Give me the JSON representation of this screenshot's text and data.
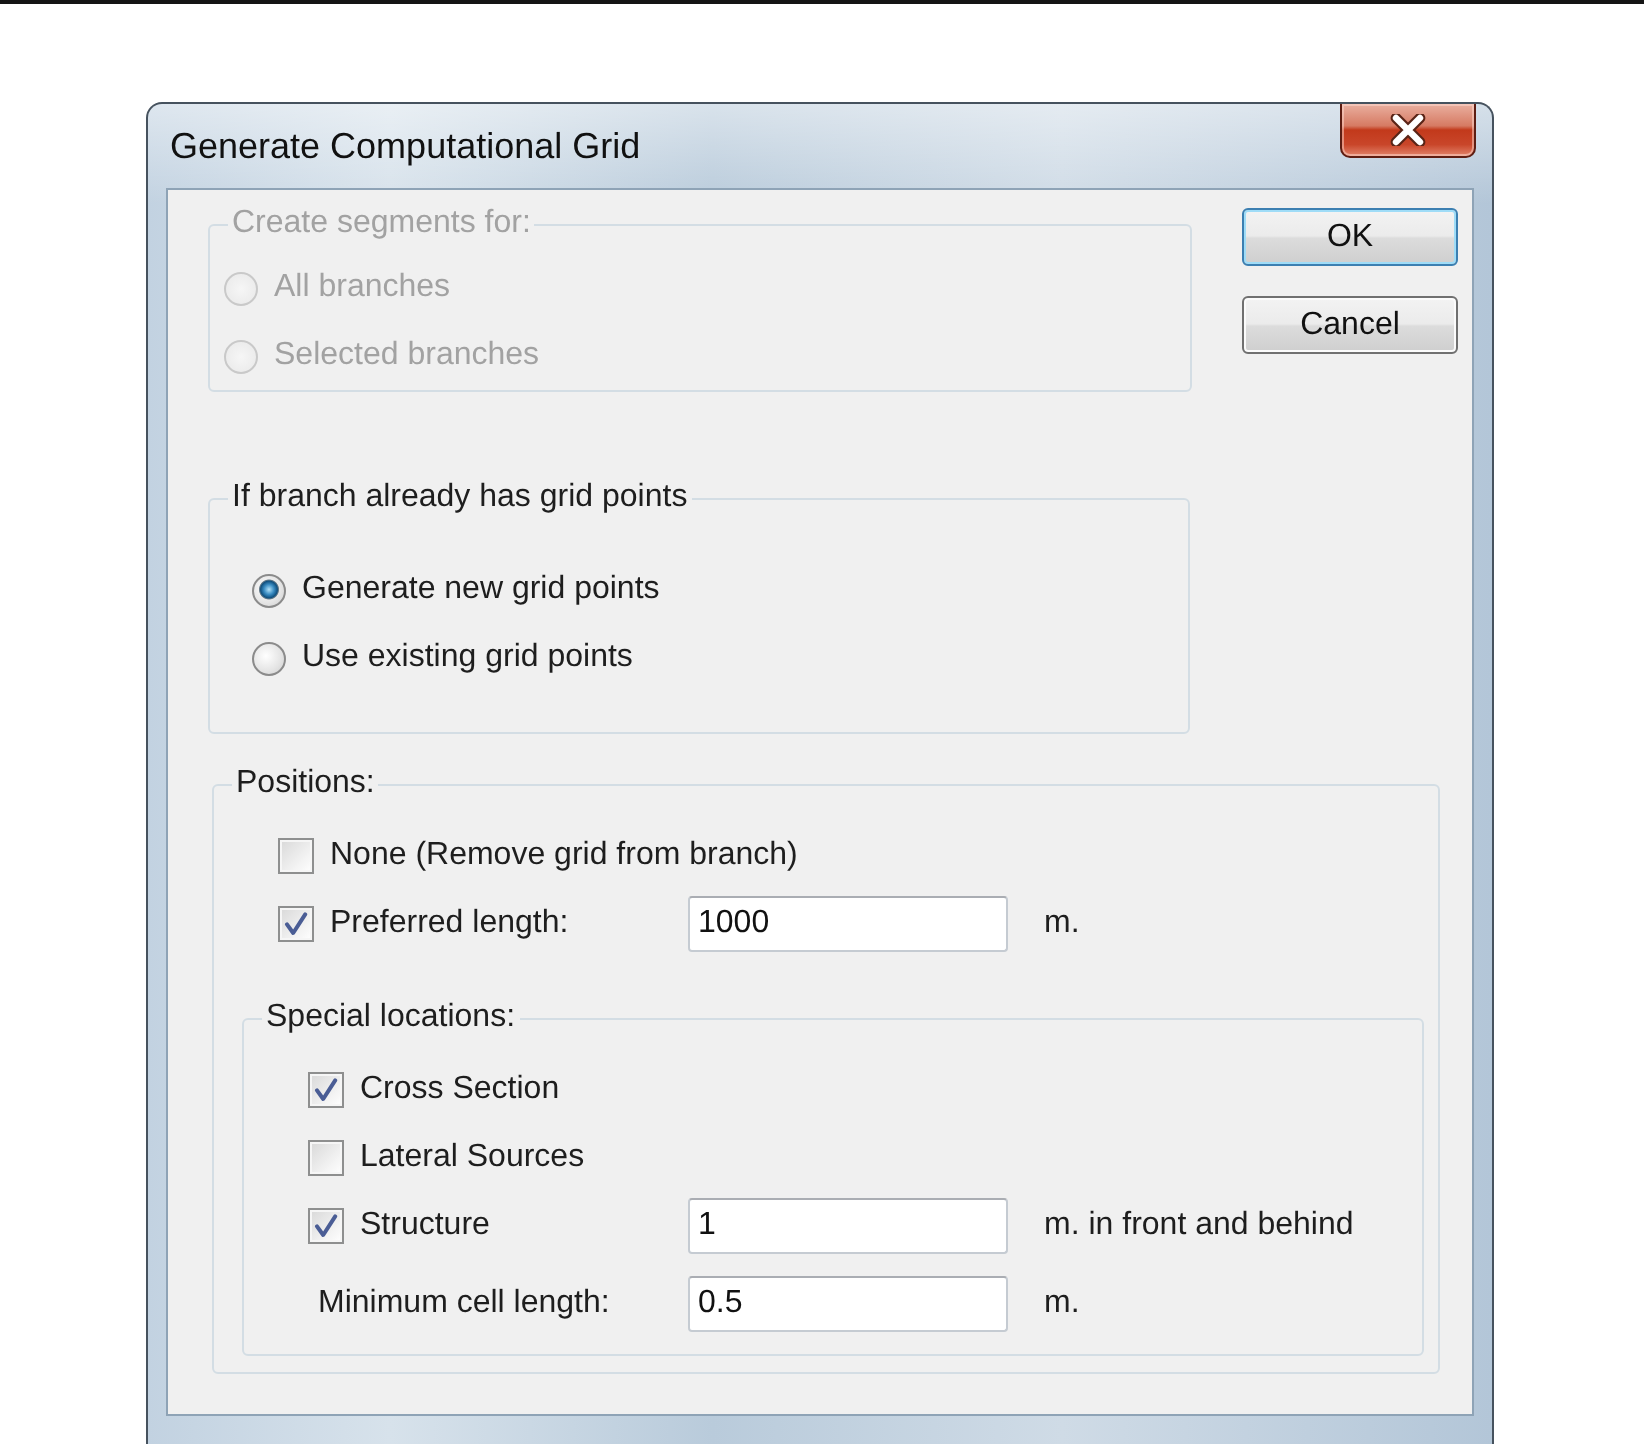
{
  "window": {
    "title": "Generate Computational Grid"
  },
  "create_segments": {
    "title": "Create segments for:",
    "disabled": true,
    "options": [
      {
        "label": "All branches",
        "selected": false
      },
      {
        "label": "Selected branches",
        "selected": false
      }
    ]
  },
  "buttons": [
    {
      "label": "OK",
      "default": true
    },
    {
      "label": "Cancel",
      "default": false
    }
  ],
  "existing_grid": {
    "title": "If branch already has grid points",
    "options": [
      {
        "label": "Generate new grid points",
        "selected": true
      },
      {
        "label": "Use existing grid points",
        "selected": false
      }
    ]
  },
  "positions": {
    "title": "Positions:",
    "rows": [
      {
        "kind": "checkbox",
        "label": "None (Remove grid from branch)",
        "checked": false
      },
      {
        "kind": "checkbox_field",
        "label": "Preferred length:",
        "checked": true,
        "value": "1000",
        "unit": "m."
      }
    ],
    "special_locations": {
      "title": "Special locations:",
      "rows": [
        {
          "kind": "checkbox",
          "label": "Cross Section",
          "checked": true
        },
        {
          "kind": "checkbox",
          "label": "Lateral Sources",
          "checked": false
        },
        {
          "kind": "checkbox_field",
          "label": "Structure",
          "checked": true,
          "value": "1",
          "unit": "m. in front and behind"
        },
        {
          "kind": "field",
          "label": "Minimum cell length:",
          "value": "0.5",
          "unit": "m."
        }
      ]
    }
  }
}
